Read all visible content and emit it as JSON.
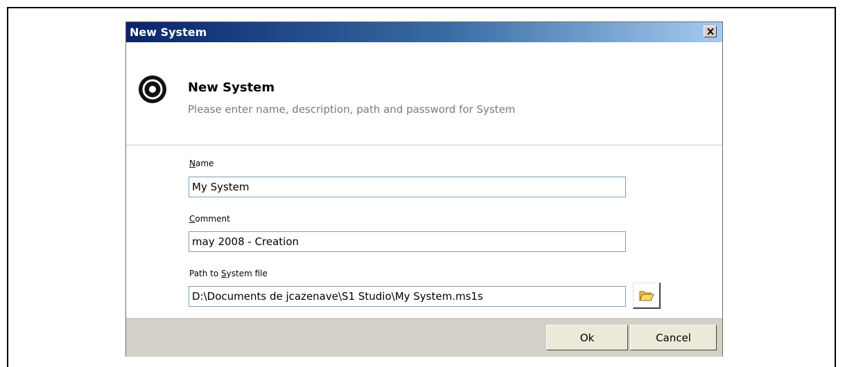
{
  "dialog": {
    "title": "New System",
    "close_label": "X"
  },
  "header": {
    "title": "New System",
    "subtitle": "Please enter name, description, path and password for System"
  },
  "fields": {
    "name": {
      "label_mnemonic": "N",
      "label_rest": "ame",
      "value": "My System"
    },
    "comment": {
      "label_mnemonic": "C",
      "label_rest": "omment",
      "value": "may 2008 - Creation"
    },
    "path": {
      "label_prefix": "Path to ",
      "label_mnemonic": "S",
      "label_rest": "ystem file",
      "value": "D:\\Documents de jcazenave\\S1 Studio\\My System.ms1s"
    }
  },
  "buttons": {
    "ok": "Ok",
    "cancel": "Cancel"
  },
  "colors": {
    "titlebar_start": "#0a246a",
    "titlebar_end": "#a6caf0",
    "footer_bg": "#d4d0c8",
    "input_border": "#7f9db9"
  },
  "icons": {
    "header": "target-ring-icon",
    "browse": "folder-open-icon"
  }
}
